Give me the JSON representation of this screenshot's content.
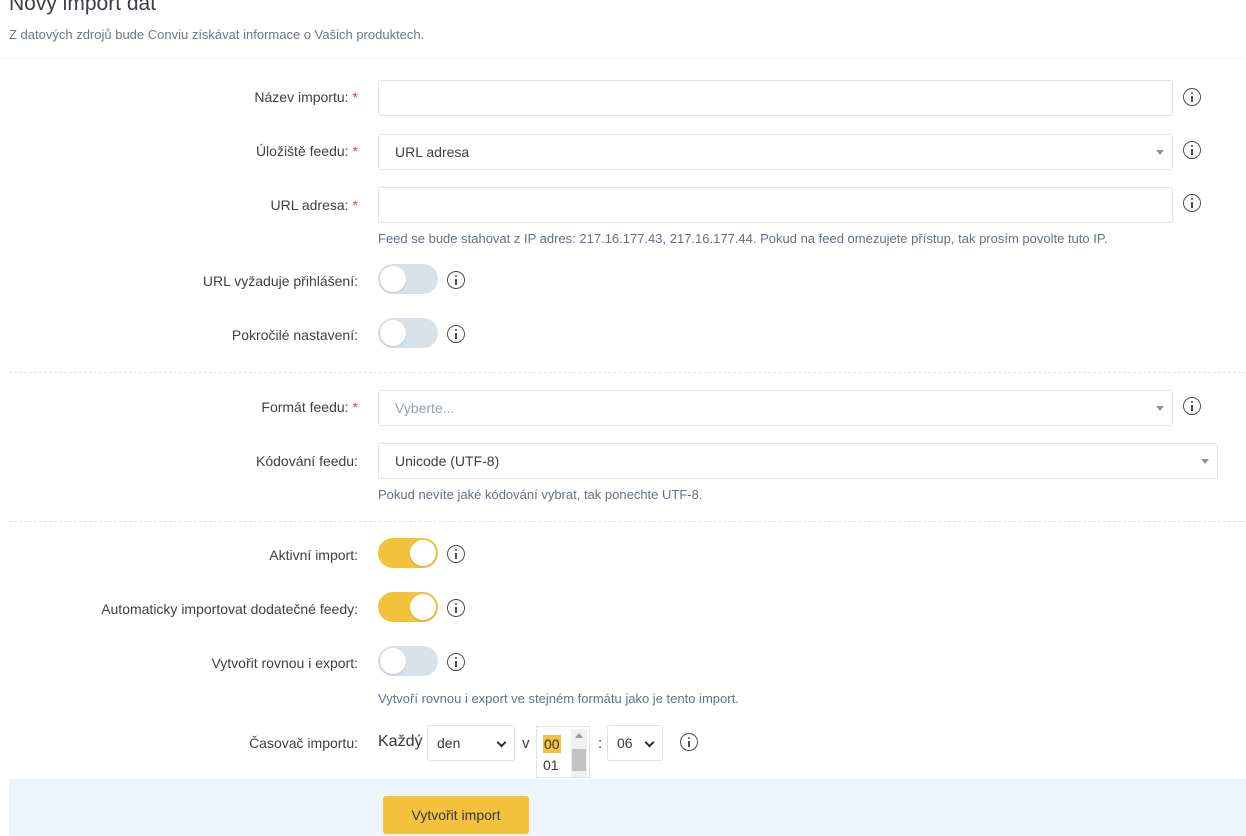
{
  "header": {
    "title": "Nový import dat",
    "subtitle": "Z datových zdrojů bude Conviu získávat informace o Vašich produktech."
  },
  "form": {
    "name": {
      "label": "Název importu:",
      "value": ""
    },
    "storage": {
      "label": "Úložiště feedu:",
      "value": "URL adresa"
    },
    "url": {
      "label": "URL adresa:",
      "value": "",
      "hint": "Feed se bude stahovat z IP adres: 217.16.177.43, 217.16.177.44. Pokud na feed omezujete přístup, tak prosím povolte tuto IP."
    },
    "url_login": {
      "label": "URL vyžaduje přihlášení:",
      "on": false
    },
    "advanced": {
      "label": "Pokročilé nastavení:",
      "on": false
    },
    "format": {
      "label": "Formát feedu:",
      "placeholder": "Vyberte..."
    },
    "encoding": {
      "label": "Kódování feedu:",
      "value": "Unicode (UTF-8)",
      "hint": "Pokud nevíte jaké kódování vybrat, tak ponechte UTF-8."
    },
    "active": {
      "label": "Aktivní import:",
      "on": true
    },
    "auto_import": {
      "label": "Automaticky importovat dodatečné feedy:",
      "on": true
    },
    "create_export": {
      "label": "Vytvořit rovnou i export:",
      "on": false,
      "hint": "Vytvoří rovnou i export ve stejném formátu jako je tento import."
    },
    "timer": {
      "label": "Časovač importu:",
      "each": "Každý",
      "period": "den",
      "at": "v",
      "hour_options": [
        "00",
        "01"
      ],
      "hour_selected": "00",
      "separator": ":",
      "minute": "06"
    }
  },
  "footer": {
    "submit_label": "Vytvořit import"
  },
  "colors": {
    "accent": "#f2c23d",
    "required": "#e23d3d",
    "hint": "#62718a",
    "footer_bg": "#eef4fb"
  }
}
